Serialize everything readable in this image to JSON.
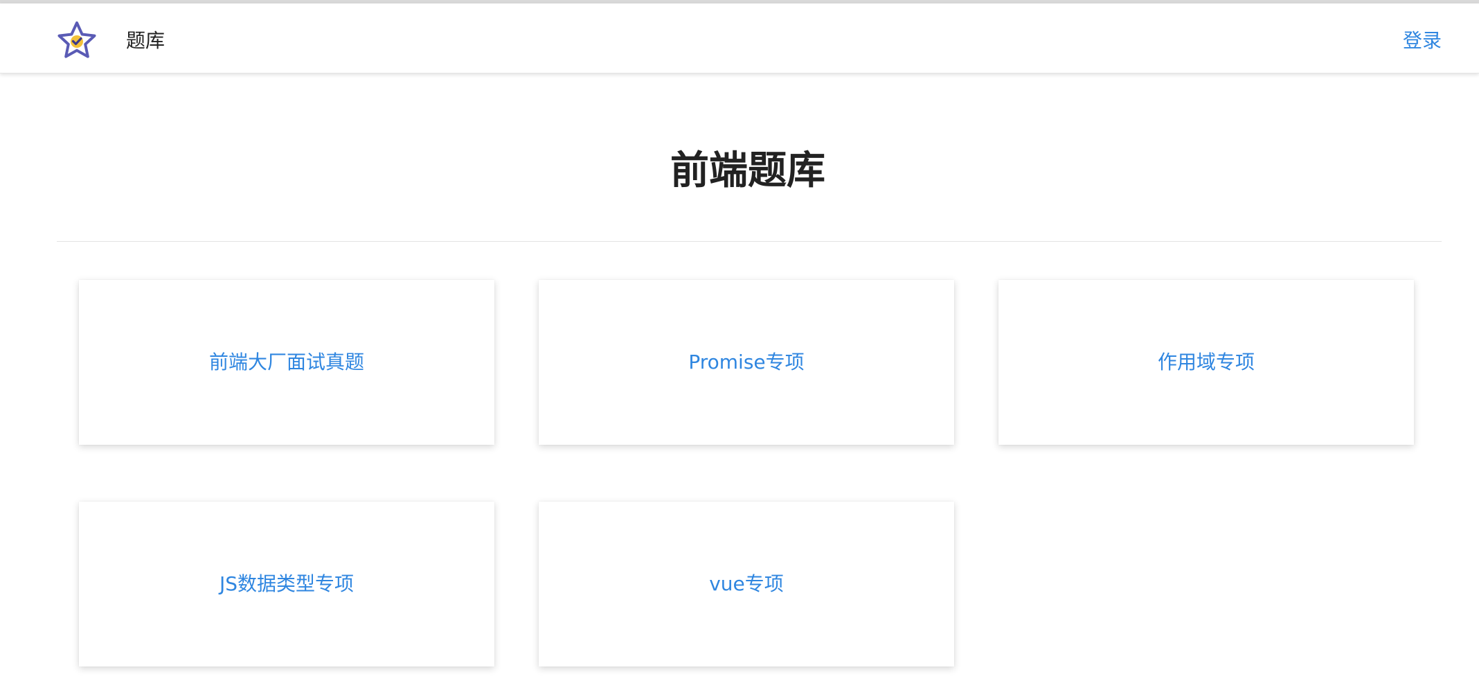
{
  "header": {
    "logo_icon": "star-check-icon",
    "site_name": "题库",
    "login_label": "登录"
  },
  "main": {
    "title": "前端题库",
    "cards": [
      {
        "label": "前端大厂面试真题"
      },
      {
        "label": "Promise专项"
      },
      {
        "label": "作用域专项"
      },
      {
        "label": "JS数据类型专项"
      },
      {
        "label": "vue专项"
      }
    ]
  },
  "colors": {
    "accent": "#2f86e0",
    "logo_outline": "#5a5bb5",
    "logo_fill": "#f3c13a",
    "text": "#222222"
  }
}
